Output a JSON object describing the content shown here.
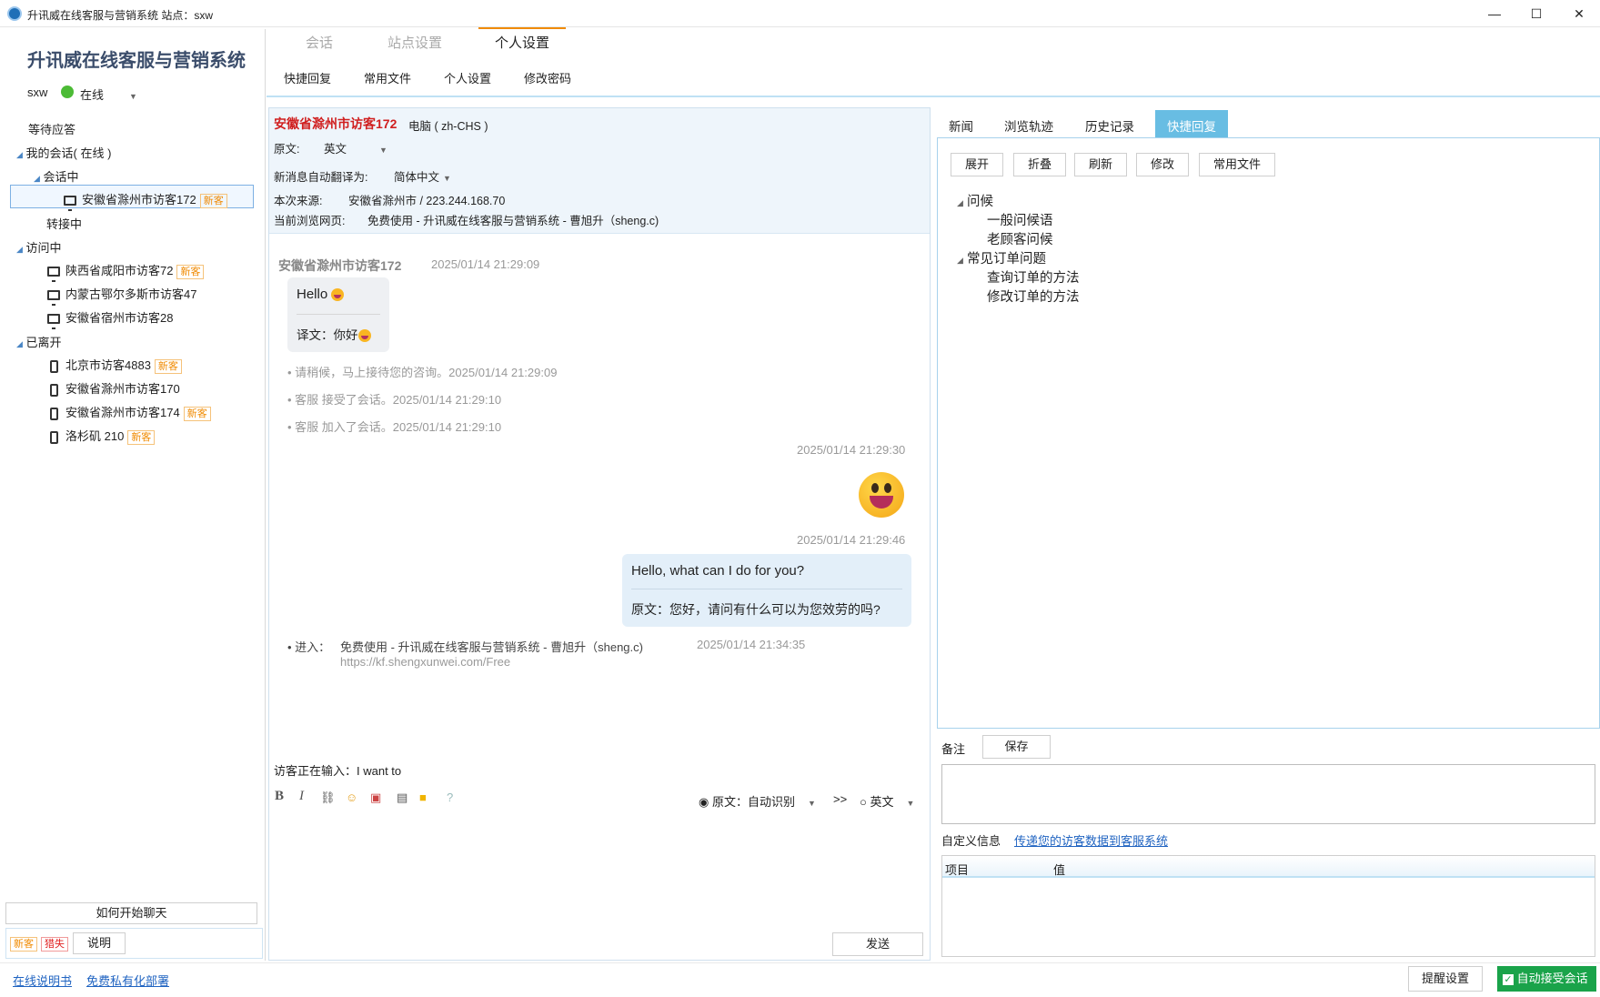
{
  "window": {
    "title": "升讯威在线客服与营销系统  站点：sxw",
    "controls": [
      "—",
      "☐",
      "✕"
    ]
  },
  "sidebar": {
    "brand": "升讯威在线客服与营销系统",
    "user": "sxw",
    "status": "在线",
    "waiting": "等待应答",
    "my_sessions": "我的会话( 在线 )",
    "in_session": "会话中",
    "current_visitor": "安徽省滁州市访客172",
    "transferring": "转接中",
    "visiting": "访问中",
    "visiting_items": [
      {
        "name": "陕西省咸阳市访客72",
        "badge": "新客"
      },
      {
        "name": "内蒙古鄂尔多斯市访客47",
        "badge": ""
      },
      {
        "name": "安徽省宿州市访客28",
        "badge": ""
      }
    ],
    "left": "已离开",
    "left_items": [
      {
        "name": "北京市访客4883",
        "badge": "新客"
      },
      {
        "name": "安徽省滁州市访客170",
        "badge": ""
      },
      {
        "name": "安徽省滁州市访客174",
        "badge": "新客"
      },
      {
        "name": "洛杉矶 210",
        "badge": "新客"
      }
    ],
    "new_badge": "新客",
    "how_to_start": "如何开始聊天",
    "legend_new": "新客",
    "legend_bad": "猎失",
    "legend_explain": "说明"
  },
  "tabs": {
    "items": [
      "会话",
      "站点设置",
      "个人设置"
    ],
    "active": "个人设置"
  },
  "subnav": [
    "快捷回复",
    "常用文件",
    "个人设置",
    "修改密码"
  ],
  "visitor": {
    "name": "安徽省滁州市访客172",
    "device": "电脑 ( zh-CHS )",
    "orig_label": "原文:",
    "orig_value": "英文",
    "auto_translate_label": "新消息自动翻译为:",
    "auto_translate_value": "简体中文",
    "source_label": "本次来源:",
    "source_value": "安徽省滁州市   /   223.244.168.70",
    "page_label": "当前浏览网页:",
    "page_value": "免费使用 - 升讯威在线客服与营销系统 - 曹旭升（sheng.c)"
  },
  "chat": {
    "visitor_name": "安徽省滁州市访客172",
    "visitor_time": "2025/01/14 21:29:09",
    "visitor_msg": "Hello",
    "visitor_translation": "译文：你好",
    "sys_msgs": [
      "请稍候，马上接待您的咨询。2025/01/14 21:29:09",
      "客服 接受了会话。2025/01/14 21:29:10",
      "客服 加入了会话。2025/01/14 21:29:10"
    ],
    "agent_time1": "2025/01/14 21:29:30",
    "agent_time2": "2025/01/14 21:29:46",
    "agent_msg": "Hello, what can I do for you?",
    "agent_original": "原文：您好，请问有什么可以为您效劳的吗?",
    "enter_label": "• 进入：",
    "enter_page": "免费使用 - 升讯威在线客服与营销系统 - 曹旭升（sheng.c)",
    "enter_time": "2025/01/14 21:34:35",
    "enter_url": "https://kf.shengxunwei.com/Free",
    "typing": "访客正在输入：I want to"
  },
  "composer": {
    "bold": "B",
    "italic": "I",
    "orig_radio": "原文：自动识别",
    "arrow": ">>",
    "target_radio": "英文",
    "send": "发送"
  },
  "right": {
    "tabs": [
      "新闻",
      "浏览轨迹",
      "历史记录",
      "快捷回复"
    ],
    "active_tab": "快捷回复",
    "buttons": [
      "展开",
      "折叠",
      "刷新",
      "修改",
      "常用文件"
    ],
    "tree": [
      {
        "group": "问候",
        "items": [
          "一般问候语",
          "老顾客问候"
        ]
      },
      {
        "group": "常见订单问题",
        "items": [
          "查询订单的方法",
          "修改订单的方法"
        ]
      }
    ],
    "note_label": "备注",
    "save": "保存",
    "custom_label": "自定义信息",
    "custom_link": "传递您的访客数据到客服系统",
    "col_item": "项目",
    "col_value": "值"
  },
  "footer": {
    "manual": "在线说明书",
    "private_deploy": "免费私有化部署",
    "reminder": "提醒设置",
    "auto_accept": "自动接受会话"
  },
  "colors": {
    "accent_blue": "#68bde3",
    "visitor_red": "#d01f1f",
    "online_green": "#4cbb36",
    "tab_orange": "#f08a00",
    "auto_accept_green": "#1aa34a"
  }
}
